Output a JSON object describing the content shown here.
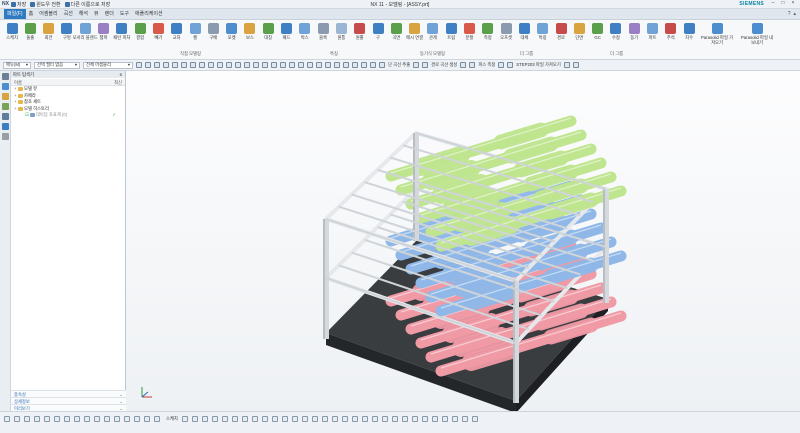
{
  "titlebar": {
    "app": "NX",
    "save": "저장",
    "quick1": "윈도우 전환",
    "quick2": "다른 이름으로 저장",
    "window_title": "NX 11 - 모델링 - [ASSY.prt]",
    "brand": "SIEMENS"
  },
  "tabs": [
    "파일(F)",
    "홈",
    "어셈블리",
    "곡선",
    "해석",
    "뷰",
    "렌더",
    "도구",
    "애플리케이션"
  ],
  "ribbon": {
    "buttons": [
      "스케치",
      "돌출",
      "회전",
      "구멍",
      "모서리 블렌드",
      "챔퍼",
      "패턴 피처",
      "결합",
      "빼기",
      "교차",
      "셸",
      "구배",
      "포켓",
      "보스",
      "대칭",
      "패드",
      "박스",
      "블록",
      "원통",
      "원뿔",
      "구",
      "곡면",
      "메시 연결",
      "관계",
      "트림",
      "분할",
      "측정",
      "오프셋",
      "대체",
      "특징",
      "경로",
      "단면",
      "GC",
      "수정",
      "동기",
      "파트",
      "주석",
      "치수"
    ],
    "groups": [
      "직접 모델링",
      "특징",
      "동기식 모델링",
      "더 그룹",
      "더 그룹"
    ],
    "right_buttons": [
      "Parasolid 파일 가져오기",
      "Parasolid 파일 내보내기"
    ]
  },
  "toolbar": {
    "menu": "메뉴(M)",
    "filter": "선택 필터 없음",
    "scope": "전체 어셈블리",
    "items": [
      "단 곡선 추출",
      "경로 곡선 생성",
      "피스 측정",
      "STEP203 파일 가져오기"
    ]
  },
  "navigator": {
    "title": "파트 탐색기",
    "columns": [
      "이름",
      "최신"
    ],
    "rows": [
      {
        "label": "모델 뷰",
        "icon": "folder"
      },
      {
        "label": "카메라",
        "icon": "folder"
      },
      {
        "label": "참조 세트",
        "icon": "folder"
      },
      {
        "label": "모델 히스토리",
        "icon": "folder"
      },
      {
        "label": "데이텀 좌표계 (0)",
        "icon": "datum",
        "ok": "✓"
      }
    ],
    "panels": [
      "종속성",
      "상세정보",
      "미리보기"
    ]
  },
  "viewport": {
    "colors": {
      "green": "#bfe58f",
      "blue": "#8fb8e8",
      "red": "#f09aa6",
      "frame": "#e6e9ec",
      "base": "#3a3d40"
    }
  },
  "statusbar": {
    "label": "스케치"
  }
}
